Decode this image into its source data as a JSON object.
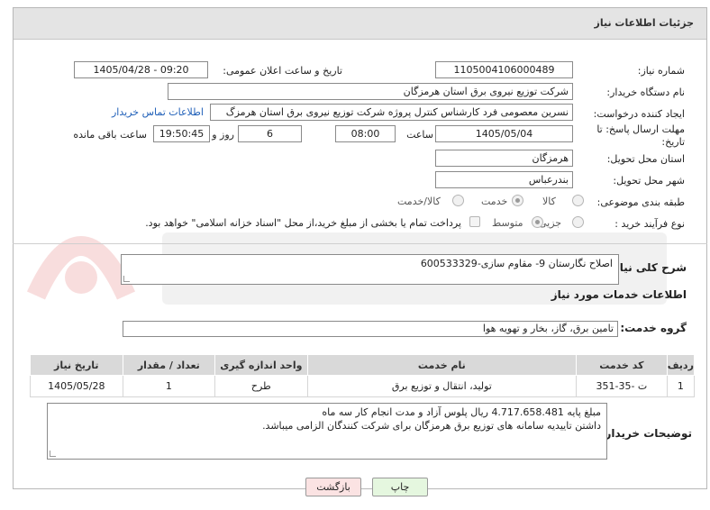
{
  "panel": {
    "title": "جزئیات اطلاعات نیاز"
  },
  "fields": {
    "need_number_label": "شماره نیاز:",
    "need_number": "1105004106000489",
    "announce_label": "تاریخ و ساعت اعلان عمومی:",
    "announce_value": "1405/04/28 - 09:20",
    "buyer_label": "نام دستگاه خریدار:",
    "buyer": "شرکت توزیع نیروی برق استان هرمزگان",
    "creator_label": "ایجاد کننده درخواست:",
    "creator": "نسرین معصومی فرد کارشناس کنترل پروژه شرکت توزیع نیروی برق استان هرمزگ",
    "contact_link": "اطلاعات تماس خریدار",
    "deadline_label": "مهلت ارسال پاسخ: تا تاریخ:",
    "deadline_date": "1405/05/04",
    "time_label": "ساعت",
    "deadline_time": "08:00",
    "days_value": "6",
    "days_label": "روز و",
    "remaining_value": "19:50:45",
    "remaining_label": "ساعت باقی مانده",
    "province_label": "استان محل تحویل:",
    "province": "هرمزگان",
    "city_label": "شهر محل تحویل:",
    "city": "بندرعباس",
    "category_label": "طبقه بندی موضوعی:",
    "category_options": [
      "کالا",
      "خدمت",
      "کالا/خدمت"
    ],
    "category_selected": "خدمت",
    "process_label": "نوع فرآیند خرید :",
    "process_options": [
      "جزیی",
      "متوسط"
    ],
    "process_selected": "متوسط",
    "payment_note": "پرداخت تمام یا بخشی از مبلغ خرید،از محل \"اسناد خزانه اسلامی\" خواهد بود."
  },
  "summary": {
    "label": "شرح کلی نیاز:",
    "text": "اصلاح نگارستان 9- مقاوم سازی-600533329"
  },
  "services": {
    "header": "اطلاعات خدمات مورد نیاز",
    "group_label": "گروه خدمت:",
    "group_value": "تامین برق، گاز، بخار و تهویه هوا",
    "columns": [
      "ردیف",
      "کد خدمت",
      "نام خدمت",
      "واحد اندازه گیری",
      "تعداد / مقدار",
      "تاریخ نیاز"
    ],
    "rows": [
      [
        "1",
        "ت -35-351",
        "تولید، انتقال و توزیع برق",
        "طرح",
        "1",
        "1405/05/28"
      ]
    ]
  },
  "buyer_notes": {
    "label": "توضیحات خریدار:",
    "line1": "مبلغ پایه 4.717.658.481 ریال پلوس آزاد و مدت انجام کار سه ماه",
    "line2": "داشتن تاییدیه سامانه های توزیع برق هرمزگان برای شرکت کنندگان الزامی میباشد."
  },
  "buttons": {
    "print": "چاپ",
    "back": "بازگشت"
  },
  "colors": {
    "print_bg": "#e5f7df",
    "back_bg": "#fbe3e3",
    "link": "#1f5fb8",
    "header_bg": "#d9d9d9"
  }
}
